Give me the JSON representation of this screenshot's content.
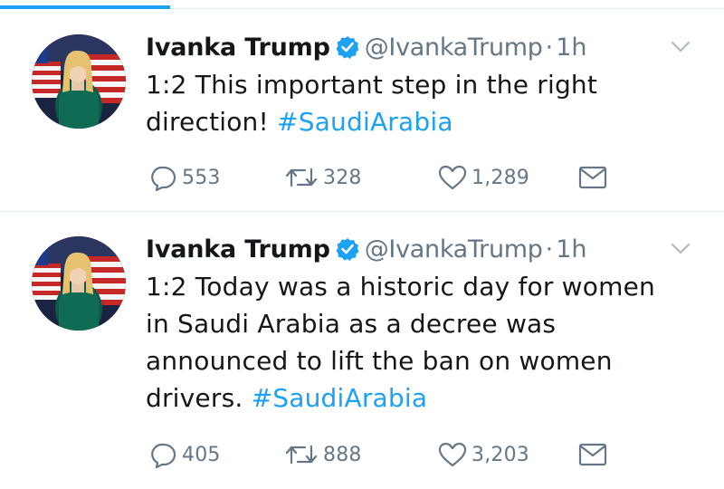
{
  "colors": {
    "accent": "#1da1f2",
    "text": "#14171a",
    "muted": "#657786",
    "divider": "#e1e8ed"
  },
  "progress": {
    "fraction": 0.235
  },
  "tweets": [
    {
      "name": "Ivanka Trump",
      "handle": "@IvankaTrump",
      "separator": "·",
      "time": "1h",
      "text_lines": [
        "1:2 This important step in the right",
        "direction!"
      ],
      "hashtag": "#SaudiArabia",
      "replies": "553",
      "retweets": "328",
      "likes": "1,289"
    },
    {
      "name": "Ivanka Trump",
      "handle": "@IvankaTrump",
      "separator": "·",
      "time": "1h",
      "text_lines": [
        "1:2 Today was a historic day for women",
        "in Saudi Arabia as a decree was",
        "announced to lift the ban on women",
        "drivers."
      ],
      "hashtag": "#SaudiArabia",
      "replies": "405",
      "retweets": "888",
      "likes": "3,203"
    }
  ],
  "icons": [
    "verified-badge-icon",
    "chevron-down-icon",
    "reply-icon",
    "retweet-icon",
    "heart-icon",
    "direct-message-icon"
  ]
}
